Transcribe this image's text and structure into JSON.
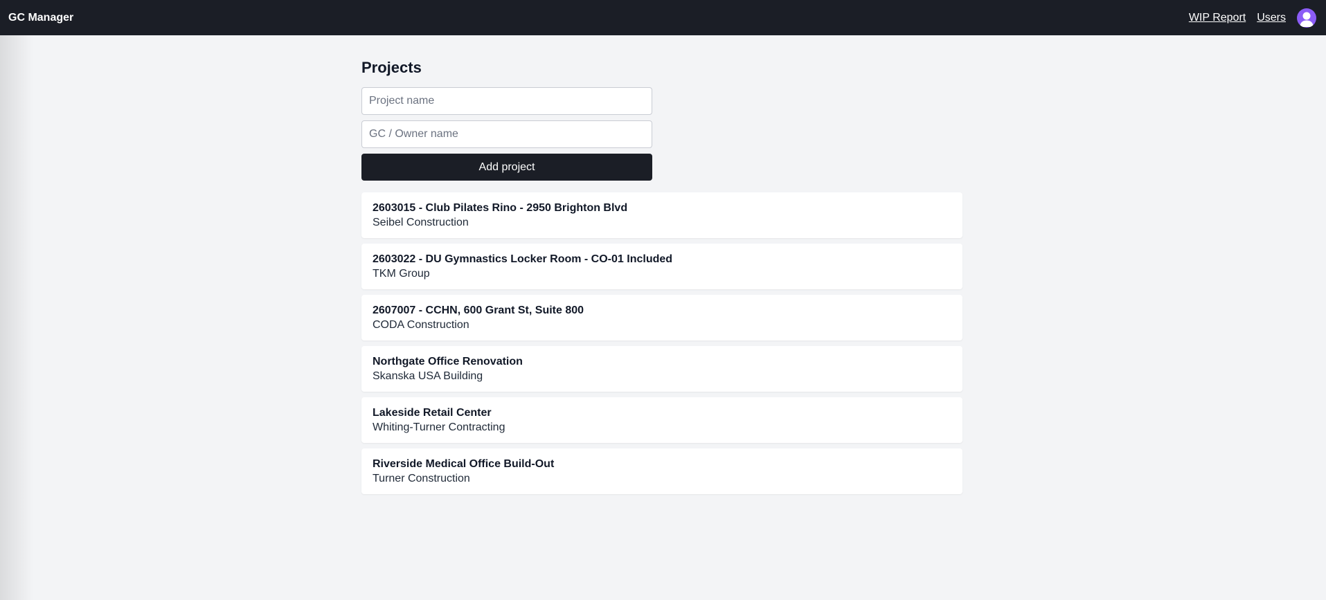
{
  "navbar": {
    "brand": "GC Manager",
    "links": [
      {
        "label": "WIP Report"
      },
      {
        "label": "Users"
      }
    ],
    "avatar_icon": "user-avatar-icon",
    "background": "#1b1e26",
    "avatar_color": "#8b5cf6"
  },
  "page": {
    "title": "Projects"
  },
  "form": {
    "project_name_placeholder": "Project name",
    "project_name_value": "",
    "owner_name_placeholder": "GC / Owner name",
    "owner_name_value": "",
    "add_label": "Add project"
  },
  "projects": [
    {
      "name": "2603015 - Club Pilates Rino - 2950 Brighton Blvd",
      "owner": "Seibel Construction"
    },
    {
      "name": "2603022 - DU Gymnastics Locker Room - CO-01 Included",
      "owner": "TKM Group"
    },
    {
      "name": "2607007 - CCHN, 600 Grant St, Suite 800",
      "owner": "CODA Construction"
    },
    {
      "name": "Northgate Office Renovation",
      "owner": "Skanska USA Building"
    },
    {
      "name": "Lakeside Retail Center",
      "owner": "Whiting-Turner Contracting"
    },
    {
      "name": "Riverside Medical Office Build-Out",
      "owner": "Turner Construction"
    }
  ]
}
